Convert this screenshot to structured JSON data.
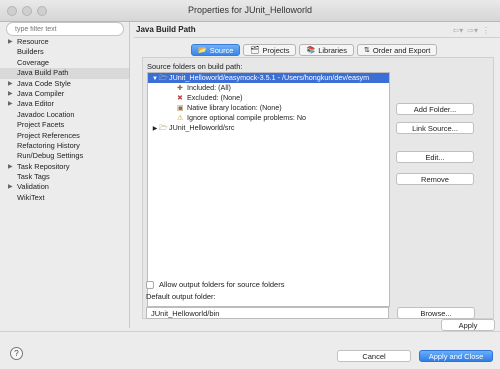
{
  "window": {
    "title": "Properties for JUnit_Helloworld"
  },
  "filter": {
    "placeholder": "type filter text"
  },
  "nav_items": [
    {
      "label": "Resource",
      "expandable": true,
      "selected": false
    },
    {
      "label": "Builders",
      "expandable": false,
      "selected": false
    },
    {
      "label": "Coverage",
      "expandable": false,
      "selected": false
    },
    {
      "label": "Java Build Path",
      "expandable": false,
      "selected": true
    },
    {
      "label": "Java Code Style",
      "expandable": true,
      "selected": false
    },
    {
      "label": "Java Compiler",
      "expandable": true,
      "selected": false
    },
    {
      "label": "Java Editor",
      "expandable": true,
      "selected": false
    },
    {
      "label": "Javadoc Location",
      "expandable": false,
      "selected": false
    },
    {
      "label": "Project Facets",
      "expandable": false,
      "selected": false
    },
    {
      "label": "Project References",
      "expandable": false,
      "selected": false
    },
    {
      "label": "Refactoring History",
      "expandable": false,
      "selected": false
    },
    {
      "label": "Run/Debug Settings",
      "expandable": false,
      "selected": false
    },
    {
      "label": "Task Repository",
      "expandable": true,
      "selected": false
    },
    {
      "label": "Task Tags",
      "expandable": false,
      "selected": false
    },
    {
      "label": "Validation",
      "expandable": true,
      "selected": false
    },
    {
      "label": "WikiText",
      "expandable": false,
      "selected": false
    }
  ],
  "panel": {
    "title": "Java Build Path"
  },
  "tabs": [
    {
      "label": "Source",
      "icon": "source-folder-icon",
      "active": true
    },
    {
      "label": "Projects",
      "icon": "projects-icon",
      "active": false
    },
    {
      "label": "Libraries",
      "icon": "libraries-icon",
      "active": false
    },
    {
      "label": "Order and Export",
      "icon": "order-export-icon",
      "active": false
    }
  ],
  "source": {
    "section_label": "Source folders on build path:",
    "rows": [
      {
        "label": "JUnit_Helloworld/easymock-3.5.1 - /Users/hongkun/dev/easym",
        "level": 0,
        "twisty": "▼",
        "icon": "folder-icon",
        "selected": true
      },
      {
        "label": "Included: (All)",
        "level": 1,
        "twisty": "",
        "icon": "included-icon",
        "selected": false
      },
      {
        "label": "Excluded: (None)",
        "level": 1,
        "twisty": "",
        "icon": "excluded-icon",
        "selected": false
      },
      {
        "label": "Native library location: (None)",
        "level": 1,
        "twisty": "",
        "icon": "native-library-icon",
        "selected": false
      },
      {
        "label": "Ignore optional compile problems: No",
        "level": 1,
        "twisty": "",
        "icon": "warning-icon",
        "selected": false
      },
      {
        "label": "JUnit_Helloworld/src",
        "level": 0,
        "twisty": "▶",
        "icon": "folder-icon",
        "selected": false
      }
    ],
    "buttons": {
      "add_folder": "Add Folder...",
      "link_source": "Link Source...",
      "edit": "Edit...",
      "remove": "Remove"
    },
    "allow_output_label": "Allow output folders for source folders",
    "allow_output_checked": false,
    "default_output_label": "Default output folder:",
    "default_output_value": "JUnit_Helloworld/bin",
    "browse": "Browse..."
  },
  "footer": {
    "apply": "Apply",
    "cancel": "Cancel",
    "apply_close": "Apply and Close",
    "help": "?"
  },
  "colors": {
    "accent": "#3b6fd6",
    "selection": "#d9d9d9"
  }
}
